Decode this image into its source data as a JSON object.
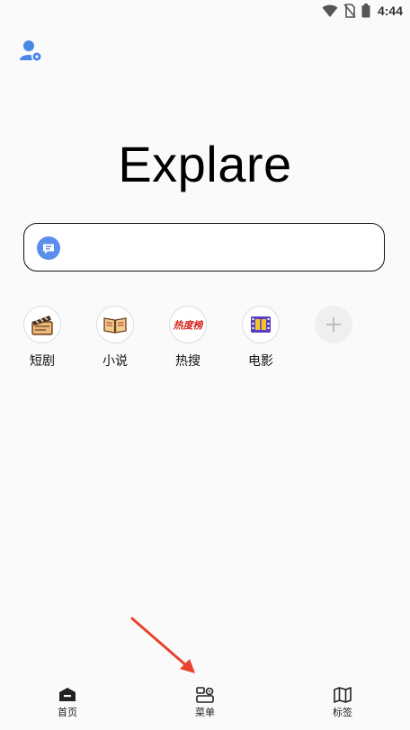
{
  "status_bar": {
    "time": "4:44",
    "icons": [
      "wifi-icon",
      "no-sim-icon",
      "battery-icon"
    ]
  },
  "header": {
    "avatar_icon": "user-avatar-icon"
  },
  "logo": {
    "text": "Explare"
  },
  "search": {
    "value": "",
    "placeholder": "",
    "engine_icon": "chat-bubble-icon",
    "accent": "#5b8def"
  },
  "shortcuts": [
    {
      "label": "短剧",
      "icon": "clapperboard-icon"
    },
    {
      "label": "小说",
      "icon": "open-book-icon"
    },
    {
      "label": "热搜",
      "icon": "hot-list-icon",
      "icon_text": "热度榜"
    },
    {
      "label": "电影",
      "icon": "film-strip-icon"
    },
    {
      "label": "",
      "icon": "plus-icon"
    }
  ],
  "bottom_nav": [
    {
      "label": "首页",
      "icon": "home-icon"
    },
    {
      "label": "菜单",
      "icon": "menu-icon"
    },
    {
      "label": "标签",
      "icon": "map-tabs-icon"
    }
  ],
  "colors": {
    "background": "#fafafa",
    "annotation_arrow": "#e8432e",
    "hot_list_red": "#d7261e"
  }
}
